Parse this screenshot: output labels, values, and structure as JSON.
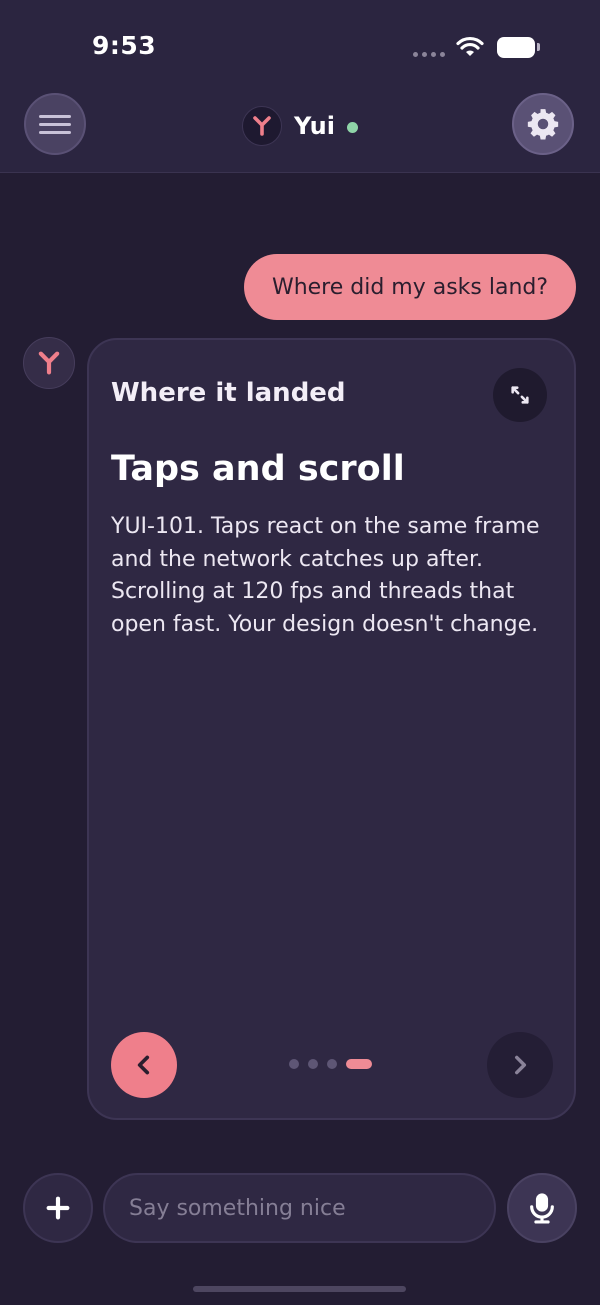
{
  "status_bar": {
    "time": "9:53"
  },
  "header": {
    "title": "Yui",
    "online": true
  },
  "messages": {
    "user": "Where did my asks land?",
    "card": {
      "kicker": "Where it landed",
      "title": "Taps and scroll",
      "body": "YUI-101. Taps react on the same frame and the network catches up after. Scrolling at 120 fps and threads that open fast. Your design doesn't change.",
      "pager": {
        "total": 4,
        "current": 4
      }
    }
  },
  "composer": {
    "placeholder": "Say something nice"
  },
  "icons": {
    "menu": "menu-icon",
    "settings": "gear-icon",
    "logo": "yui-logo-icon",
    "expand": "expand-icon",
    "prev": "chevron-left-icon",
    "next": "chevron-right-icon",
    "add": "plus-icon",
    "mic": "microphone-icon"
  },
  "colors": {
    "accent": "#ef8b95",
    "background": "#231d33",
    "header": "#2b2540",
    "card": "#2f2843",
    "online": "#8fd4a8"
  }
}
